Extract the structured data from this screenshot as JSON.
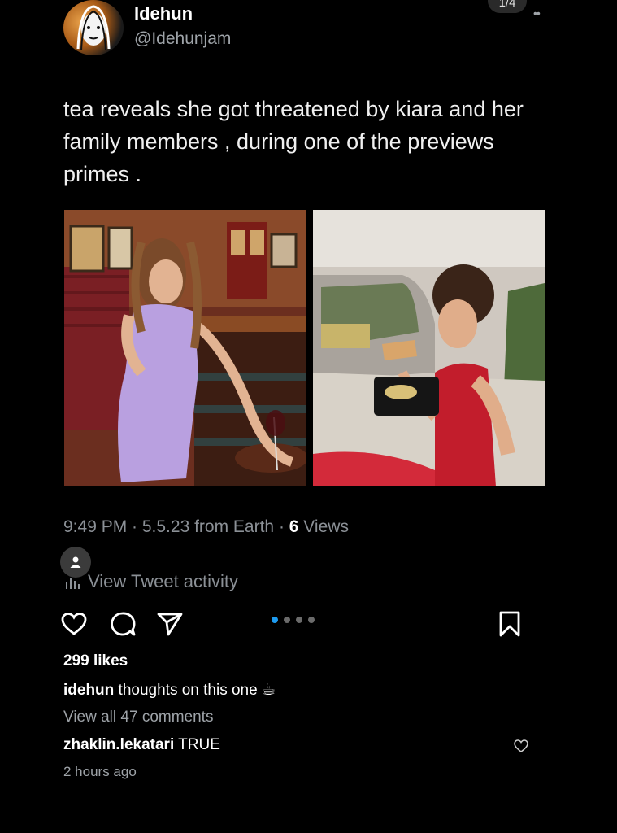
{
  "post": {
    "display_name": "Idehun",
    "handle": "@Idehunjam",
    "page_counter": "1/4",
    "text": "tea reveals she got threatened by kiara and her family members , during one of the previews primes .",
    "meta_prefix": "9:49 PM · 5.5.23 from Earth · ",
    "views_count": "6",
    "views_label": " Views",
    "activity_label": "View Tweet activity"
  },
  "carousel": {
    "total": 4,
    "active_index": 0
  },
  "feed": {
    "likes": "299 likes",
    "caption_user": "idehun",
    "caption_text": " thoughts on this one ☕",
    "view_comments": "View all 47 comments",
    "comment_user": "zhaklin.lekatari",
    "comment_text": " TRUE",
    "time_ago": "2 hours ago"
  },
  "icons": {
    "like": "heart-icon",
    "comment": "comment-bubble-icon",
    "share": "paper-plane-icon",
    "save": "bookmark-icon",
    "activity": "bar-chart-icon",
    "profile": "person-icon"
  },
  "colors": {
    "background": "#000000",
    "accent": "#1d9bf0",
    "muted": "#8b9096"
  }
}
